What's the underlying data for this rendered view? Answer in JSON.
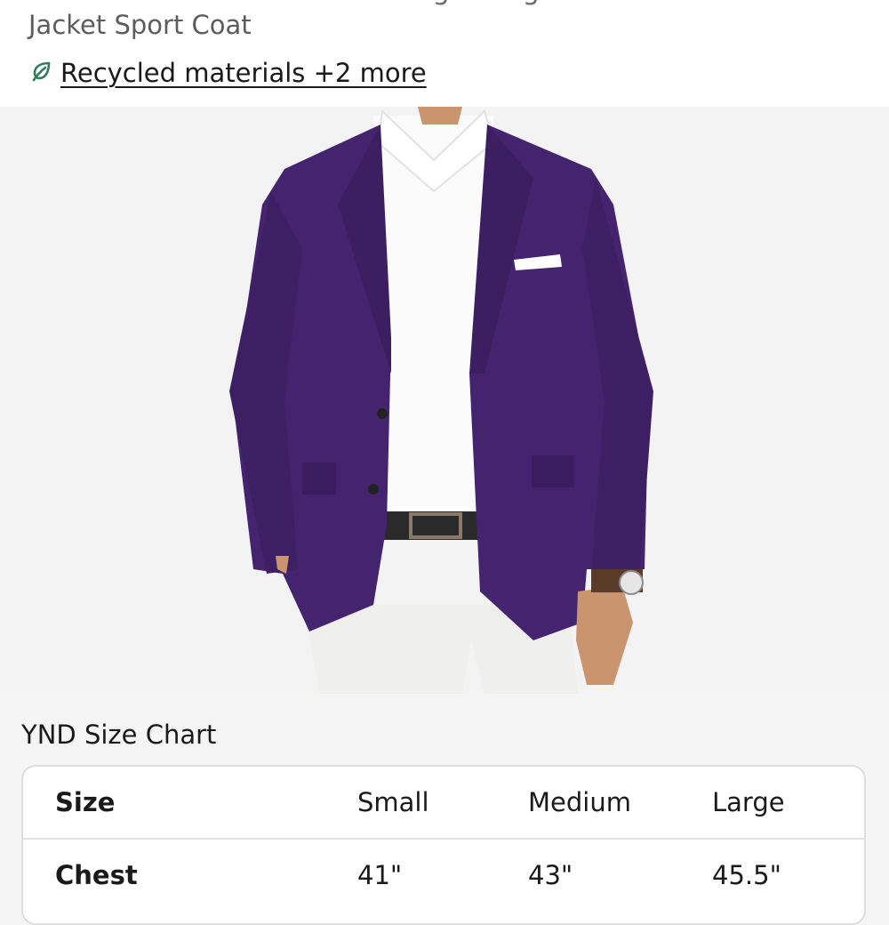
{
  "product": {
    "title_line_prev": "Men's Casual Blazer Slim Fit Lightweight",
    "title_line": "Jacket Sport Coat",
    "eco_link": "Recycled materials +2 more",
    "eco_icon": "leaf-icon",
    "accent_color": "#2e7d5b",
    "jacket_color": "#45246f"
  },
  "size_chart": {
    "title": "YND Size Chart",
    "header": [
      "Size",
      "Small",
      "Medium",
      "Large"
    ],
    "rows": [
      [
        "Chest",
        "41\"",
        "43\"",
        "45.5\""
      ]
    ]
  }
}
